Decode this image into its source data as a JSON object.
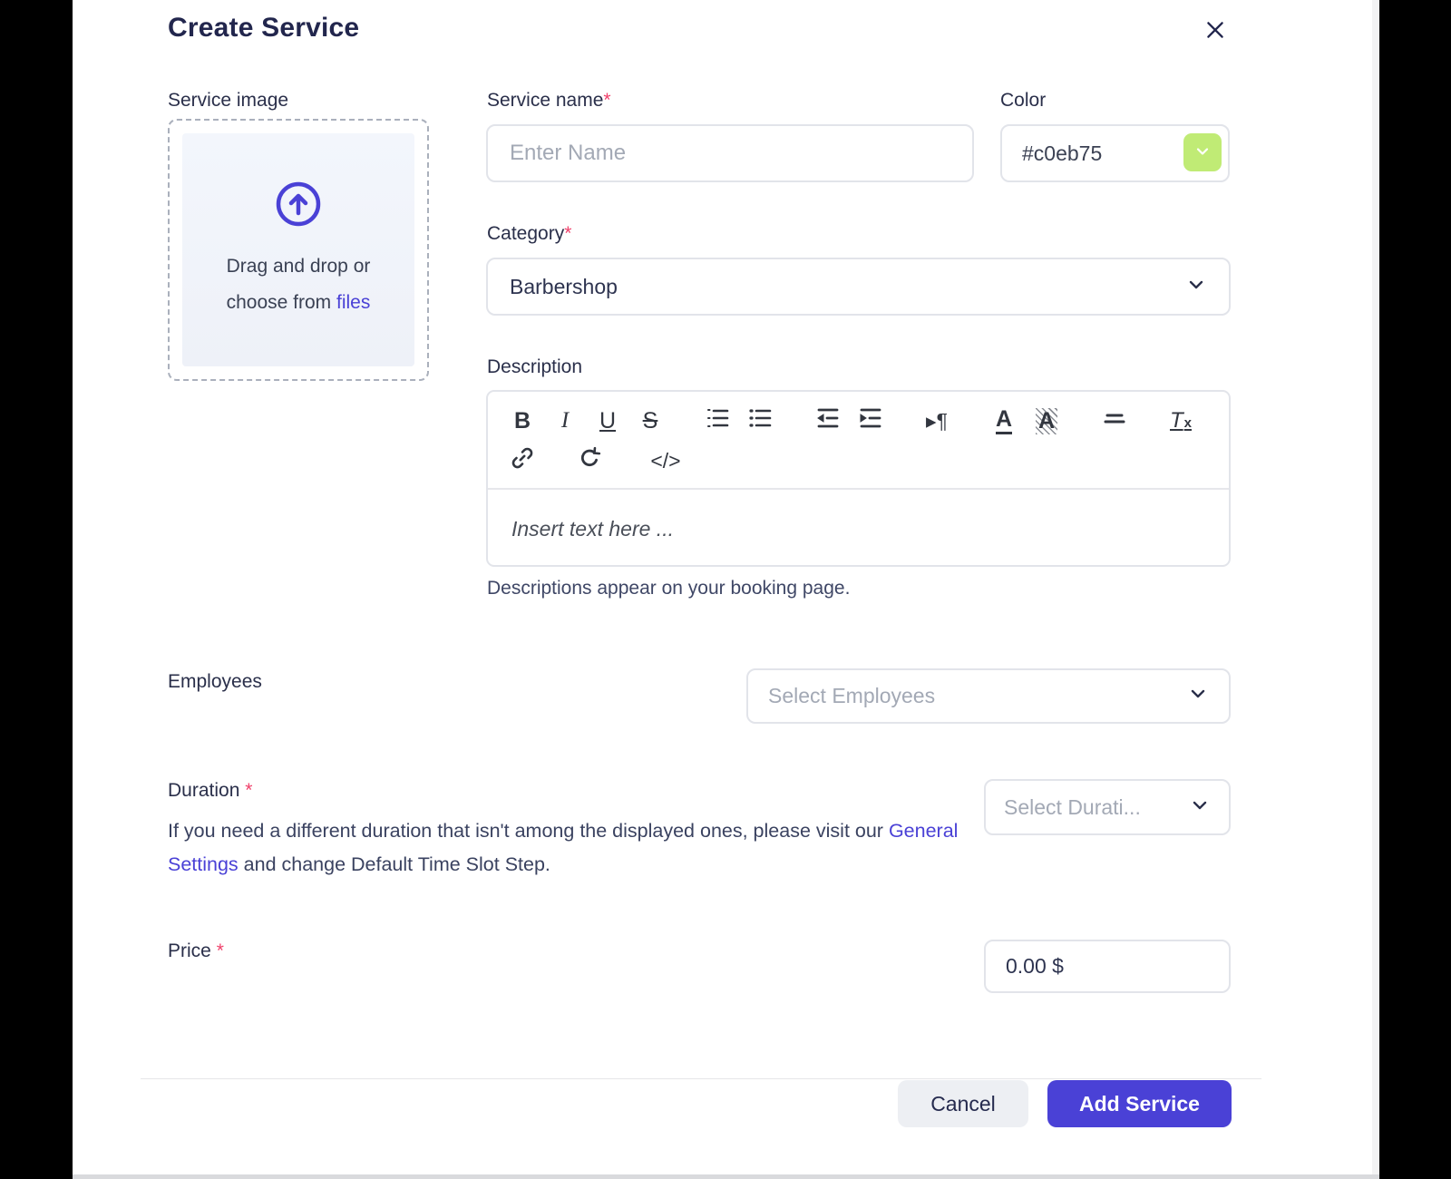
{
  "modal": {
    "title": "Create Service"
  },
  "icons": [
    "close-icon",
    "upload-arrow-icon",
    "chevron-down-icon",
    "ordered-list-icon",
    "bullet-list-icon",
    "outdent-icon",
    "indent-icon",
    "paragraph-direction-icon",
    "text-color-icon",
    "highlight-icon",
    "lines-icon",
    "clear-format-icon",
    "link-icon",
    "undo-icon",
    "code-icon"
  ],
  "colors": {
    "accent": "#4a41d6",
    "swatch_green": "#c0eb75",
    "navy_text": "#22264d",
    "asterisk_pink": "#f0416b"
  },
  "fields": {
    "service_image": {
      "label": "Service image",
      "drop_line1": "Drag and drop or",
      "drop_line2_prefix": "choose from ",
      "drop_link": "files"
    },
    "service_name": {
      "label": "Service name",
      "required": "*",
      "placeholder": "Enter Name"
    },
    "color": {
      "label": "Color",
      "value": "#c0eb75"
    },
    "category": {
      "label": "Category",
      "required": "*",
      "value": "Barbershop"
    },
    "description": {
      "label": "Description",
      "placeholder": "Insert text here ...",
      "helper": "Descriptions appear on your booking page.",
      "toolbar": {
        "bold": "B",
        "italic": "I",
        "underline": "U",
        "strikethrough": "S",
        "direction": "▸¶",
        "text_color": "A",
        "highlight": "A",
        "clear_prefix": "T",
        "clear_suffix": "x",
        "code": "</>"
      }
    },
    "employees": {
      "label": "Employees",
      "placeholder": "Select Employees"
    },
    "duration": {
      "label": "Duration",
      "required": "*",
      "helper_prefix": "If you need a different duration that isn't among the displayed ones, please visit our ",
      "helper_link": "General Settings",
      "helper_suffix": " and change Default Time Slot Step.",
      "placeholder": "Select Durati..."
    },
    "price": {
      "label": "Price",
      "required": "*",
      "value": "0.00 $"
    }
  },
  "footer": {
    "cancel": "Cancel",
    "submit": "Add Service"
  }
}
